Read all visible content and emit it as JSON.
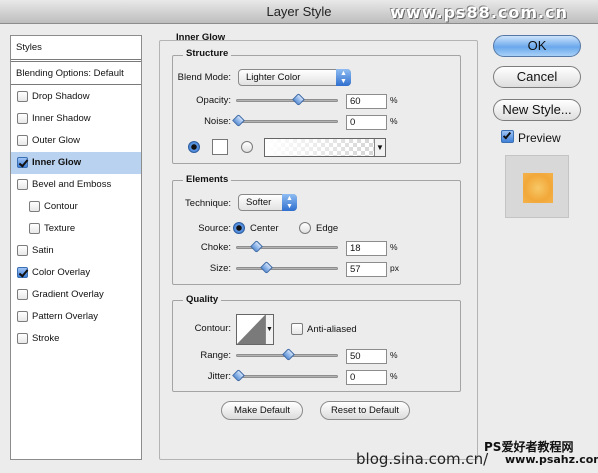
{
  "window": {
    "title": "Layer Style"
  },
  "watermarks": {
    "top": "www.ps88.com.cn",
    "cn": "PS爱好者教程网",
    "site": "www.psahz.com",
    "blog": "blog.sina.com.cn/"
  },
  "sidebar": {
    "styles_label": "Styles",
    "blending_label": "Blending Options: Default",
    "items": [
      {
        "label": "Drop Shadow",
        "checked": false,
        "indent": false
      },
      {
        "label": "Inner Shadow",
        "checked": false,
        "indent": false
      },
      {
        "label": "Outer Glow",
        "checked": false,
        "indent": false
      },
      {
        "label": "Inner Glow",
        "checked": true,
        "indent": false,
        "selected": true
      },
      {
        "label": "Bevel and Emboss",
        "checked": false,
        "indent": false
      },
      {
        "label": "Contour",
        "checked": false,
        "indent": true
      },
      {
        "label": "Texture",
        "checked": false,
        "indent": true
      },
      {
        "label": "Satin",
        "checked": false,
        "indent": false
      },
      {
        "label": "Color Overlay",
        "checked": true,
        "indent": false
      },
      {
        "label": "Gradient Overlay",
        "checked": false,
        "indent": false
      },
      {
        "label": "Pattern Overlay",
        "checked": false,
        "indent": false
      },
      {
        "label": "Stroke",
        "checked": false,
        "indent": false
      }
    ]
  },
  "panel": {
    "title": "Inner Glow",
    "structure": {
      "legend": "Structure",
      "blend_mode_label": "Blend Mode:",
      "blend_mode_value": "Lighter Color",
      "opacity_label": "Opacity:",
      "opacity_value": "60",
      "opacity_level": 60,
      "noise_label": "Noise:",
      "noise_value": "0",
      "noise_level": 0,
      "unit": "%"
    },
    "elements": {
      "legend": "Elements",
      "technique_label": "Technique:",
      "technique_value": "Softer",
      "source_label": "Source:",
      "source_center": "Center",
      "source_edge": "Edge",
      "choke_label": "Choke:",
      "choke_value": "18",
      "choke_level": 18,
      "size_label": "Size:",
      "size_value": "57",
      "size_level": 57,
      "pct": "%",
      "px": "px"
    },
    "quality": {
      "legend": "Quality",
      "contour_label": "Contour:",
      "antialiased_label": "Anti-aliased",
      "range_label": "Range:",
      "range_value": "50",
      "range_level": 50,
      "jitter_label": "Jitter:",
      "jitter_value": "0",
      "jitter_level": 0,
      "unit": "%"
    },
    "make_default": "Make Default",
    "reset_default": "Reset to Default"
  },
  "actions": {
    "ok": "OK",
    "cancel": "Cancel",
    "new_style": "New Style...",
    "preview": "Preview",
    "preview_checked": true
  },
  "colors": {
    "preview_swatch": "#f2a83a",
    "selected_row": "#b9d2ef",
    "accent": "#3f80d8"
  }
}
